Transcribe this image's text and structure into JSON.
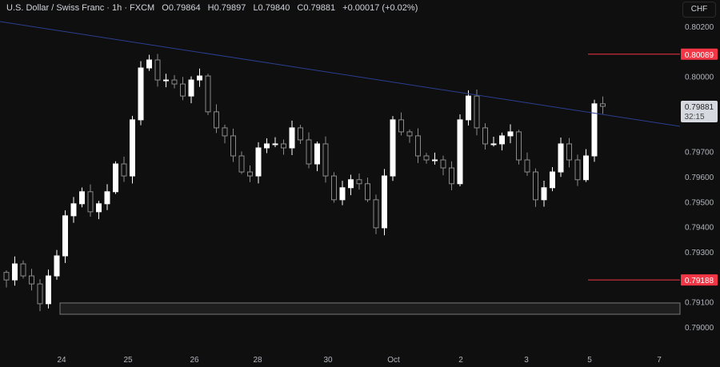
{
  "header": {
    "symbol": "U.S. Dollar / Swiss Franc · 1h · FXCM",
    "open": "O0.79864",
    "high": "H0.79897",
    "low": "L0.79840",
    "close": "C0.79881",
    "change": "+0.00017 (+0.02%)"
  },
  "currency_button": "CHF",
  "colors": {
    "background": "#0f0f0f",
    "up": "#ffffff",
    "down": "#8a8a8a",
    "trendline": "#2a3f8f",
    "level": "#f23645",
    "zone": "#1e1e1e"
  },
  "chart_data": {
    "type": "candlestick",
    "title": "U.S. Dollar / Swiss Franc · 1h · FXCM",
    "ylim": [
      0.7885,
      0.8027
    ],
    "y_ticks": [
      "0.80200",
      "0.80000",
      "0.79700",
      "0.79600",
      "0.79500",
      "0.79400",
      "0.79300",
      "0.79100",
      "0.79000"
    ],
    "y_tick_values": [
      0.802,
      0.8,
      0.797,
      0.796,
      0.795,
      0.794,
      0.793,
      0.791,
      0.79
    ],
    "x_ticks": [
      {
        "label": "24",
        "bar": 7
      },
      {
        "label": "25",
        "bar": 15
      },
      {
        "label": "26",
        "bar": 23
      },
      {
        "label": "28",
        "bar": 30
      },
      {
        "label": "30",
        "bar": 39
      },
      {
        "label": "Oct",
        "bar": 46
      },
      {
        "label": "2",
        "bar": 54
      },
      {
        "label": "3",
        "bar": 62
      },
      {
        "label": "5",
        "bar": 70
      },
      {
        "label": "7",
        "bar": 78
      }
    ],
    "closes": [
      0.79188,
      0.79252,
      0.79204,
      0.79172,
      0.79093,
      0.79204,
      0.79284,
      0.79444,
      0.79492,
      0.7954,
      0.7946,
      0.79492,
      0.7954,
      0.79651,
      0.79603,
      0.79827,
      0.80034,
      0.80066,
      0.79986,
      0.79986,
      0.7997,
      0.79922,
      0.79986,
      0.80002,
      0.79859,
      0.79795,
      0.79763,
      0.79683,
      0.79619,
      0.79603,
      0.79715,
      0.79731,
      0.79731,
      0.79715,
      0.79795,
      0.79747,
      0.79651,
      0.79731,
      0.79603,
      0.79508,
      0.79556,
      0.79588,
      0.79572,
      0.79508,
      0.79396,
      0.79603,
      0.79827,
      0.79779,
      0.79763,
      0.79683,
      0.79667,
      0.79667,
      0.79635,
      0.79572,
      0.79827,
      0.79922,
      0.79795,
      0.79731,
      0.79731,
      0.79763,
      0.79779,
      0.79667,
      0.79619,
      0.79508,
      0.79556,
      0.79619,
      0.79731,
      0.79667,
      0.79588,
      0.79683,
      0.79891,
      0.79881
    ],
    "trendline": {
      "start_price": 0.80219,
      "end_price": 0.79801
    },
    "levels": [
      {
        "price": 0.80089,
        "label": "0.80089"
      },
      {
        "price": 0.79188,
        "label": "0.79188"
      }
    ],
    "zone": {
      "top": 0.79096,
      "bottom": 0.79051
    },
    "last_price": {
      "label": "0.79881",
      "countdown": "32:15",
      "price": 0.79881
    }
  }
}
